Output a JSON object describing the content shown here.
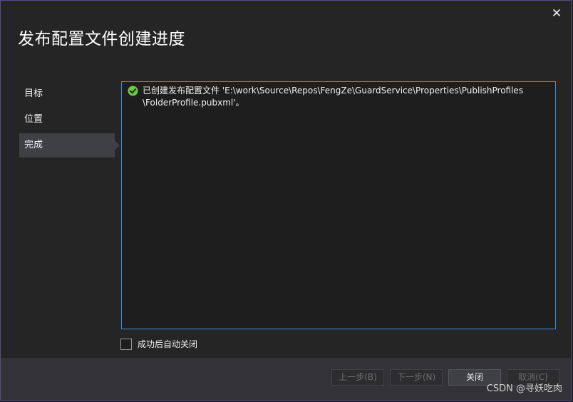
{
  "dialog": {
    "title": "发布配置文件创建进度",
    "close_glyph": "✕"
  },
  "nav": {
    "items": [
      {
        "label": "目标"
      },
      {
        "label": "位置"
      },
      {
        "label": "完成",
        "active": true
      }
    ]
  },
  "log": {
    "status_icon": "check-circle-icon",
    "status_color": "#6cc644",
    "message": "已创建发布配置文件 'E:\\work\\Source\\Repos\\FengZe\\GuardService\\Properties\\PublishProfiles\n\\FolderProfile.pubxml'。"
  },
  "auto_close": {
    "label": "成功后自动关闭",
    "checked": false
  },
  "buttons": {
    "prev": "上一步(B)",
    "next": "下一步(N)",
    "close": "关闭",
    "cancel": "取消(C)"
  },
  "watermark": "CSDN @寻妖吃肉"
}
